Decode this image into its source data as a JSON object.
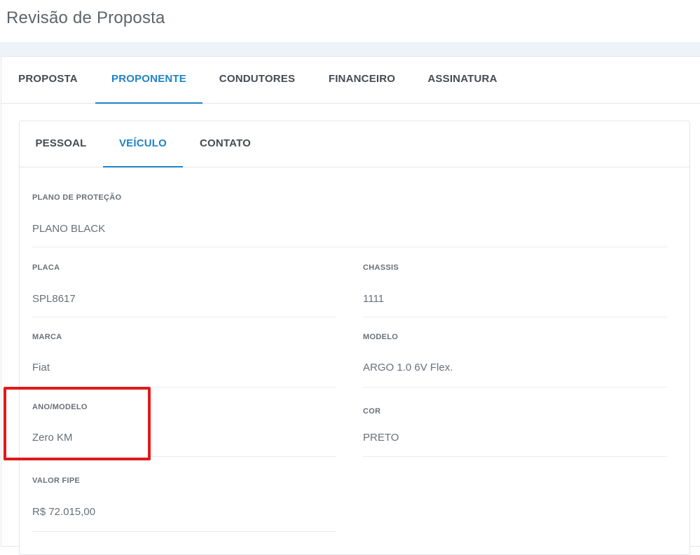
{
  "page": {
    "title": "Revisão de Proposta"
  },
  "outer_tabs": [
    {
      "label": "PROPOSTA",
      "active": false
    },
    {
      "label": "PROPONENTE",
      "active": true
    },
    {
      "label": "CONDUTORES",
      "active": false
    },
    {
      "label": "FINANCEIRO",
      "active": false
    },
    {
      "label": "ASSINATURA",
      "active": false
    }
  ],
  "inner_tabs": [
    {
      "label": "PESSOAL",
      "active": false
    },
    {
      "label": "VEÍCULO",
      "active": true
    },
    {
      "label": "CONTATO",
      "active": false
    }
  ],
  "vehicle": {
    "plano": {
      "label": "PLANO DE PROTEÇÃO",
      "value": "PLANO BLACK"
    },
    "placa": {
      "label": "PLACA",
      "value": "SPL8617"
    },
    "chassis": {
      "label": "CHASSIS",
      "value": "1111"
    },
    "marca": {
      "label": "MARCA",
      "value": "Fiat"
    },
    "modelo": {
      "label": "MODELO",
      "value": "ARGO 1.0 6V Flex."
    },
    "ano_modelo": {
      "label": "ANO/MODELO",
      "value": "Zero KM"
    },
    "cor": {
      "label": "COR",
      "value": "PRETO"
    },
    "valor_fipe": {
      "label": "VALOR FIPE",
      "value": "R$ 72.015,00"
    }
  },
  "colors": {
    "accent": "#1f83c9",
    "highlight": "#e11a1a",
    "band": "#eef3f9"
  }
}
